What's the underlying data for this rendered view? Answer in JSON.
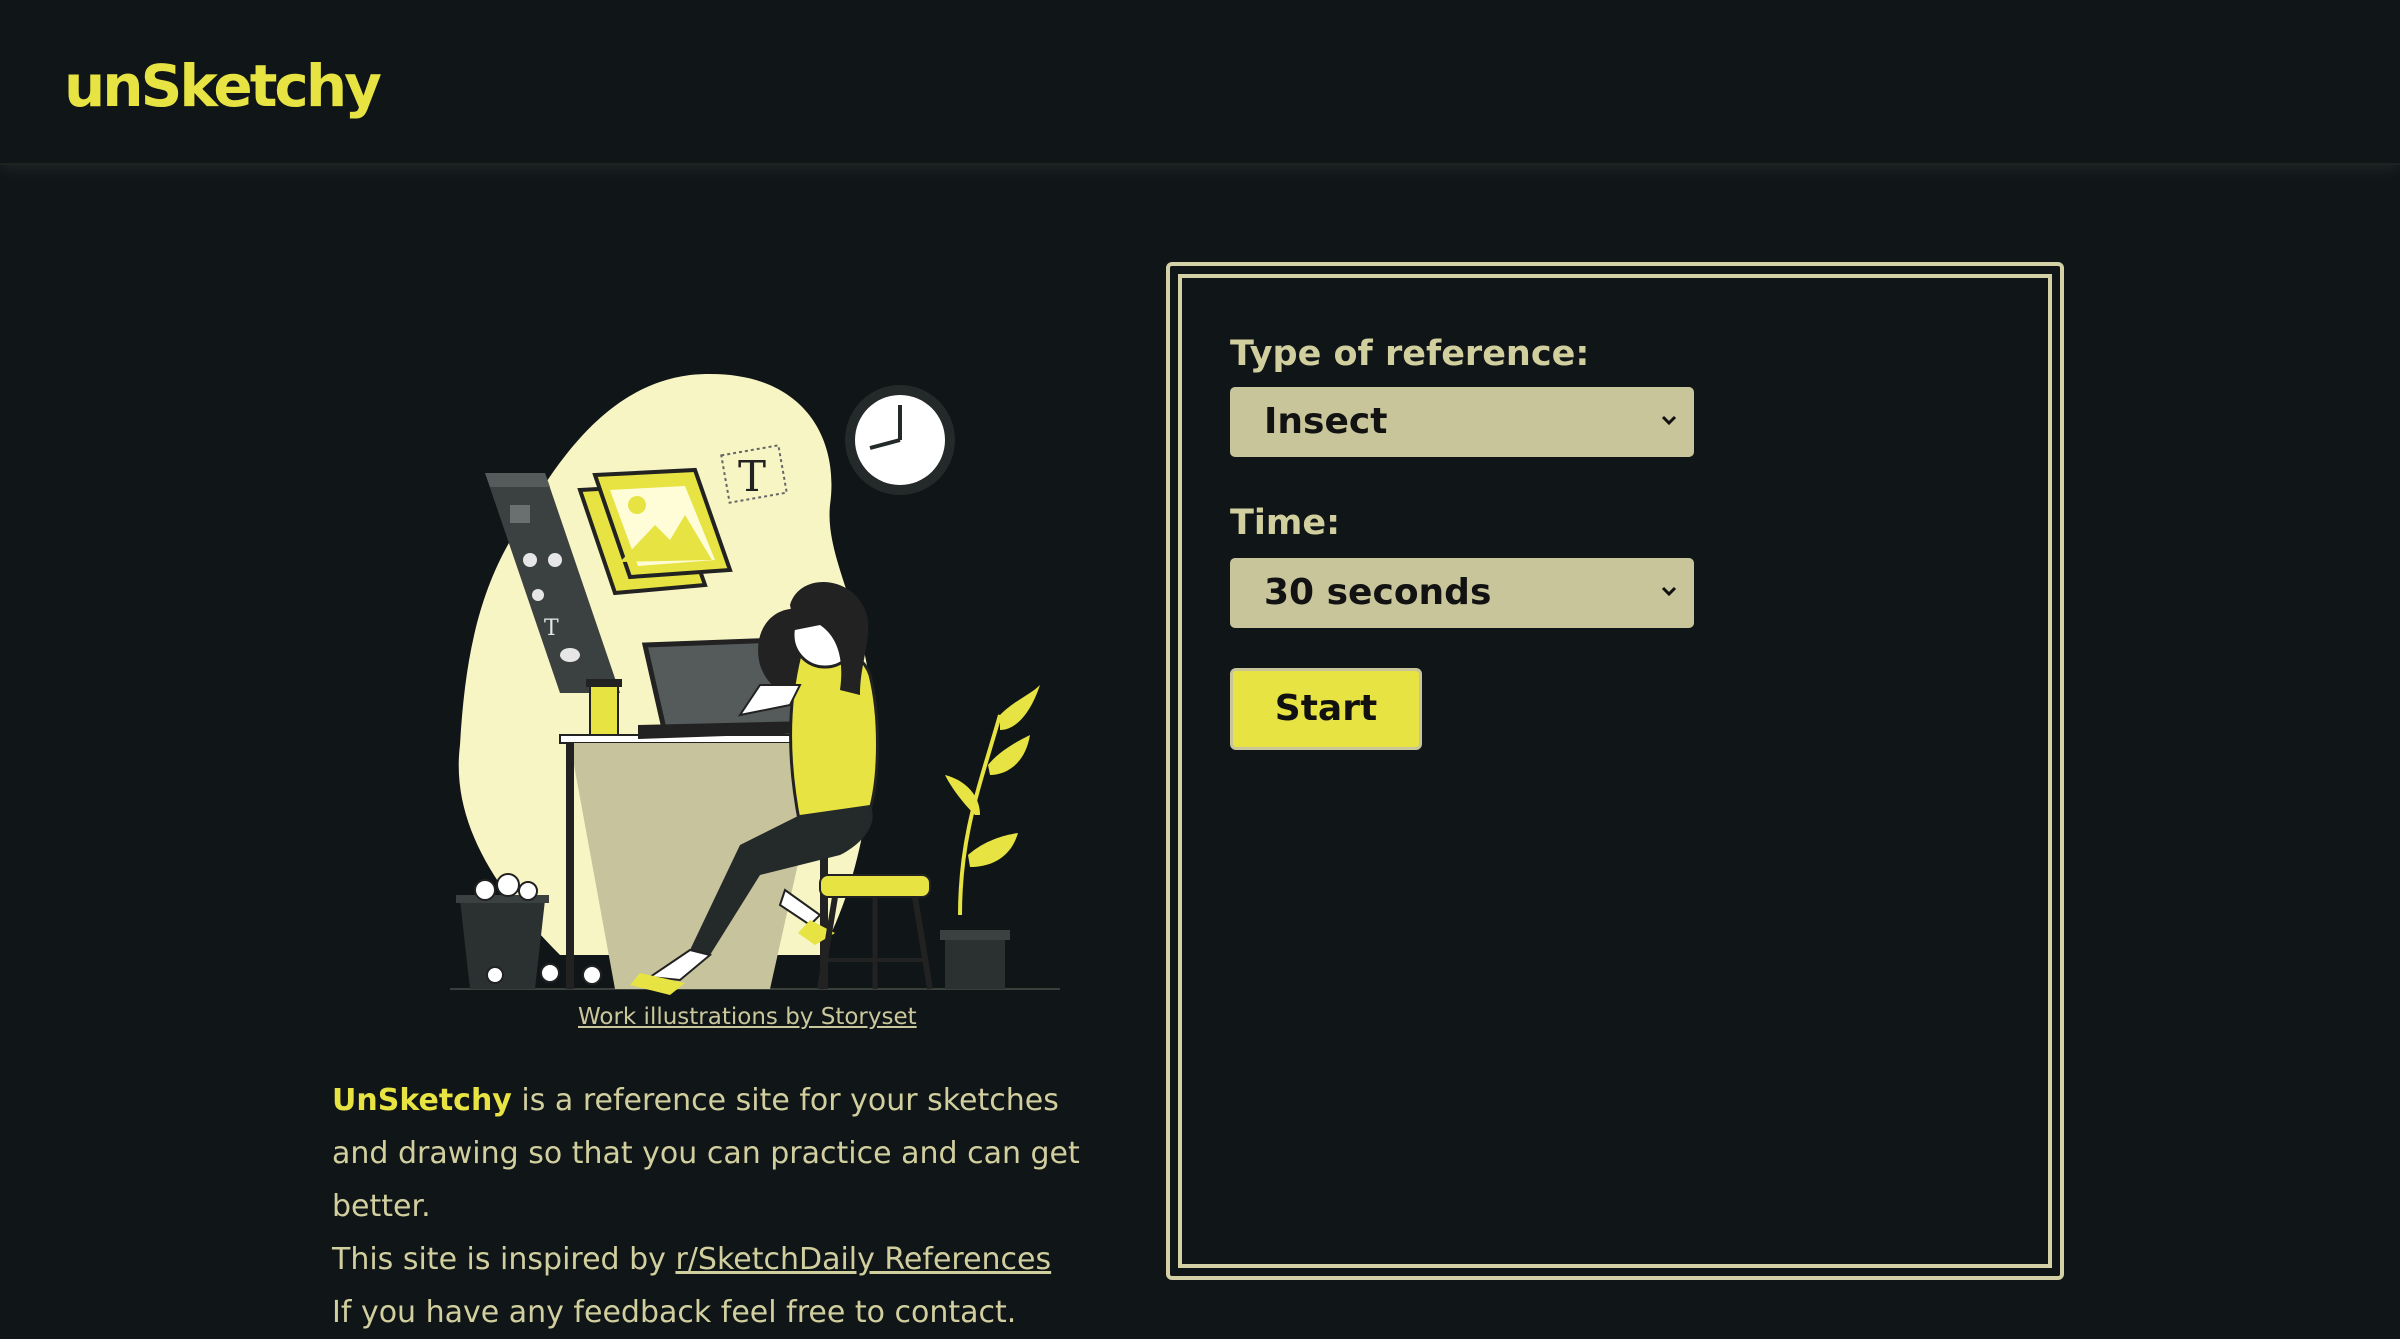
{
  "header": {
    "logo_text": "unSketchy"
  },
  "illustration": {
    "name": "woman drawing at desk illustration",
    "credit_text": "Work illustrations by Storyset"
  },
  "about": {
    "brand": "UnSketchy",
    "line1_rest": " is a reference site for your sketches and drawing so that you can practice and can get better.",
    "inspired_prefix": "This site is inspired by ",
    "inspired_link": "r/SketchDaily References",
    "feedback": "If you have any feedback feel free to contact."
  },
  "form": {
    "reference_label": "Type of reference:",
    "reference_value": "Insect",
    "time_label": "Time:",
    "time_value": "30 seconds",
    "start_label": "Start"
  },
  "colors": {
    "background": "#101517",
    "accent": "#e6e342",
    "text": "#d2cf9f",
    "select_bg": "#c8c59b"
  }
}
